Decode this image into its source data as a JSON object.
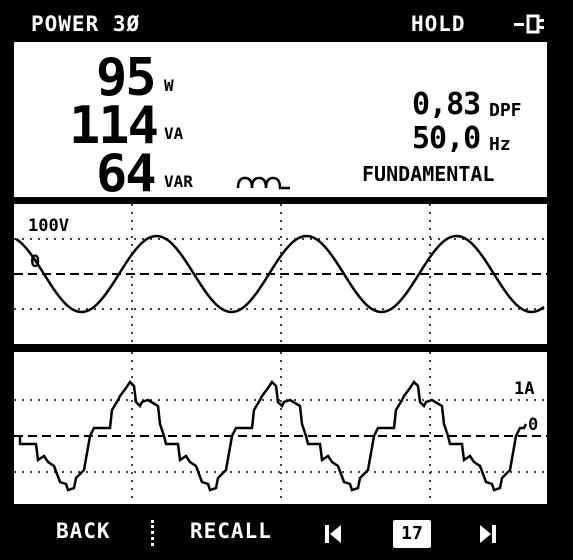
{
  "header": {
    "title": "POWER 3Ø",
    "hold_label": "HOLD",
    "plug_icon": "power-plug-icon"
  },
  "readings": {
    "watts_value": "95",
    "watts_unit": "W",
    "va_value": "114",
    "va_unit": "VA",
    "var_value": "64",
    "var_unit": "VAR",
    "inductive_icon": "inductive-load-coil-icon",
    "dpf_value": "0,83",
    "dpf_unit": "DPF",
    "freq_value": "50,0",
    "freq_unit": "Hz",
    "mode": "FUNDAMENTAL"
  },
  "voltage_trace": {
    "scale_label": "100V",
    "zero_label": "0"
  },
  "current_trace": {
    "scale_label": "1A",
    "zero_label": "0"
  },
  "softkeys": {
    "back": "BACK",
    "recall": "RECALL",
    "prev_icon": "skip-previous-icon",
    "page_number": "17",
    "next_icon": "skip-next-icon"
  },
  "colors": {
    "background": "#000000",
    "panel": "#ffffff",
    "foreground": "#000000"
  }
}
